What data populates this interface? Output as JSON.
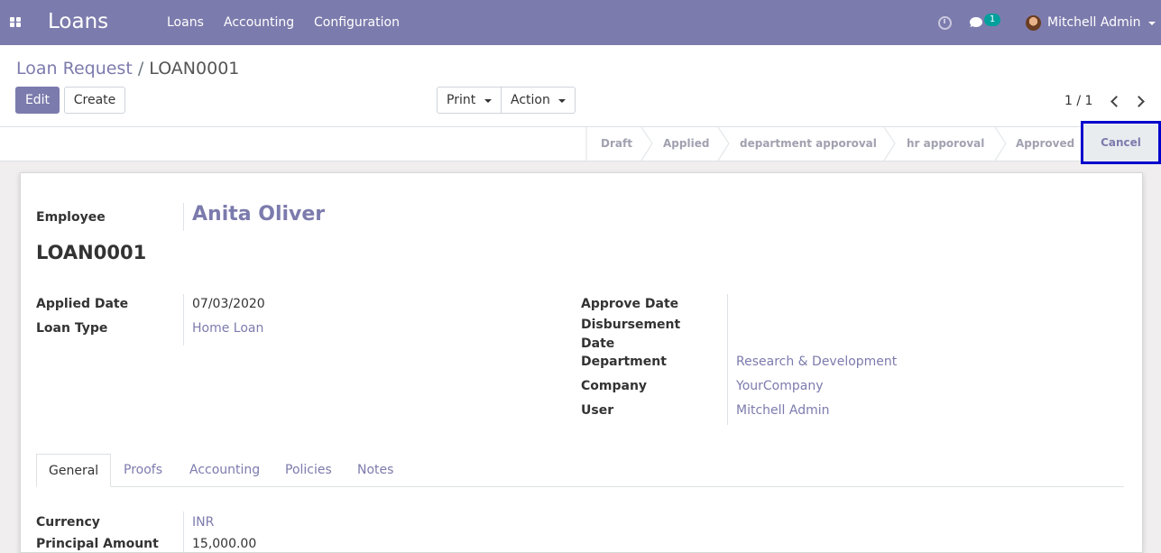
{
  "navbar": {
    "app_title": "Loans",
    "menu": [
      "Loans",
      "Accounting",
      "Configuration"
    ],
    "chat_count": "1",
    "user_name": "Mitchell Admin"
  },
  "breadcrumb": {
    "parent": "Loan Request",
    "separator": "/",
    "current": "LOAN0001"
  },
  "buttons": {
    "edit": "Edit",
    "create": "Create",
    "print": "Print",
    "action": "Action"
  },
  "pager": {
    "value": "1 / 1"
  },
  "stages": [
    "Draft",
    "Applied",
    "department apporoval",
    "hr apporoval",
    "Approved",
    "Cancel"
  ],
  "form": {
    "employee_label": "Employee",
    "employee_value": "Anita Oliver",
    "loan_number": "LOAN0001",
    "left_fields": [
      {
        "label": "Applied Date",
        "value": "07/03/2020"
      },
      {
        "label": "Loan Type",
        "value": "Home Loan"
      }
    ],
    "right_fields": [
      {
        "label": "Approve Date",
        "value": ""
      },
      {
        "label": "Disbursement Date",
        "value": ""
      },
      {
        "label": "Department",
        "value": "Research & Development"
      },
      {
        "label": "Company",
        "value": "YourCompany"
      },
      {
        "label": "User",
        "value": "Mitchell Admin"
      }
    ],
    "tabs": [
      "General",
      "Proofs",
      "Accounting",
      "Policies",
      "Notes"
    ],
    "general": [
      {
        "label": "Currency",
        "value": "INR"
      },
      {
        "label": "Principal Amount",
        "value": "15,000.00"
      }
    ]
  },
  "colors": {
    "brand": "#7c7bad",
    "badge": "#00a09d",
    "highlight_border": "#0000cc"
  }
}
